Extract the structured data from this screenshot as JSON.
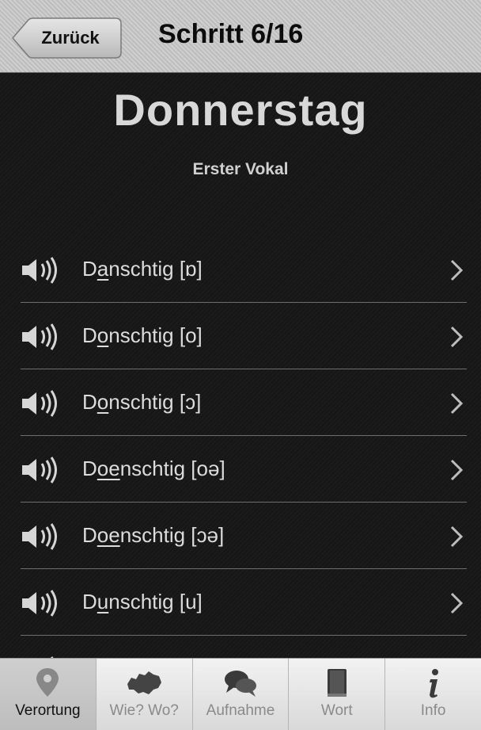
{
  "nav": {
    "back_label": "Zurück",
    "title": "Schritt 6/16"
  },
  "main": {
    "word": "Donnerstag",
    "subtitle": "Erster Vokal"
  },
  "variants": [
    {
      "pre": "D",
      "vowel": "a",
      "post": "nschtig [ɒ]"
    },
    {
      "pre": "D",
      "vowel": "o",
      "post": "nschtig [o]"
    },
    {
      "pre": "D",
      "vowel": "o",
      "post": "nschtig [ɔ]"
    },
    {
      "pre": "D",
      "vowel": "oe",
      "post": "nschtig [oə]"
    },
    {
      "pre": "D",
      "vowel": "oe",
      "post": "nschtig [ɔə]"
    },
    {
      "pre": "D",
      "vowel": "u",
      "post": "nschtig [u]"
    }
  ],
  "tabs": [
    {
      "label": "Verortung",
      "icon": "location-pin-icon",
      "active": true
    },
    {
      "label": "Wie? Wo?",
      "icon": "switzerland-map-icon",
      "active": false
    },
    {
      "label": "Aufnahme",
      "icon": "speech-bubbles-icon",
      "active": false
    },
    {
      "label": "Wort",
      "icon": "book-icon",
      "active": false
    },
    {
      "label": "Info",
      "icon": "info-icon",
      "active": false
    }
  ]
}
